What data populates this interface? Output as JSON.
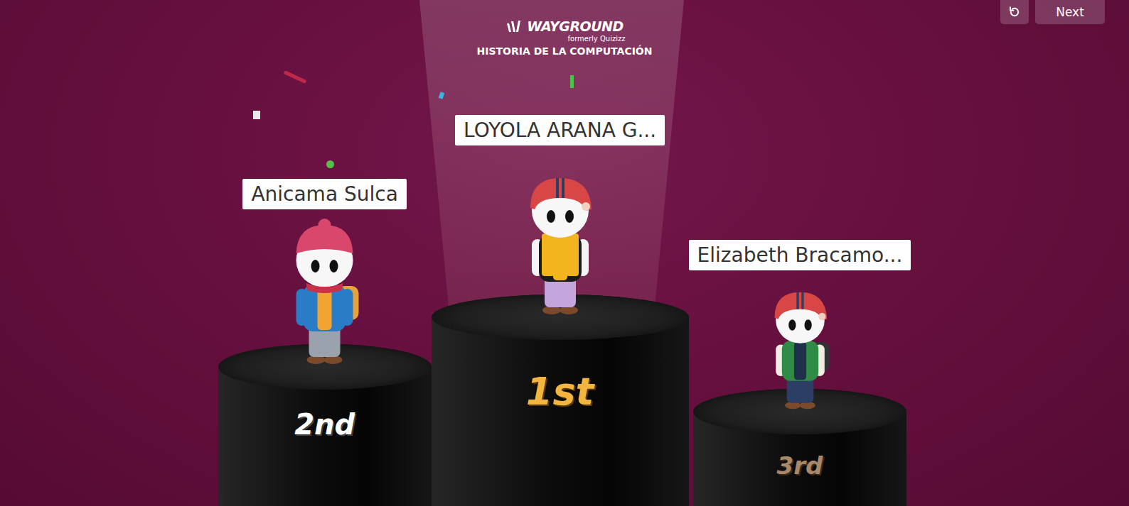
{
  "toolbar": {
    "next_button": "Next"
  },
  "brand": {
    "logo": "WAYGROUND",
    "subtitle": "formerly Quizizz"
  },
  "quiz_title": "HISTORIA DE LA COMPUTACIÓN",
  "podium": [
    {
      "name": "Anicama Sulca",
      "place": "2nd",
      "kind": "beanie"
    },
    {
      "name": "LOYOLA ARANA G...",
      "place": "1st",
      "kind": "helmet-scarf"
    },
    {
      "name": "Elizabeth Bracamo...",
      "place": "3rd",
      "kind": "helmet-jacket"
    }
  ]
}
